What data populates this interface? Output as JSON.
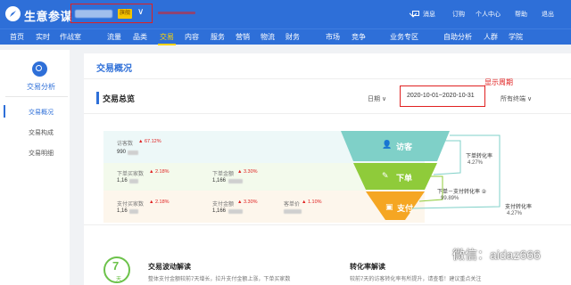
{
  "header": {
    "app_title": "生意参谋",
    "shop_badge": "旗舰",
    "links": [
      "消息",
      "订购",
      "个人中心",
      "帮助",
      "退出"
    ]
  },
  "nav": {
    "items": [
      "首页",
      "实时",
      "作战室",
      "流量",
      "品类",
      "交易",
      "内容",
      "服务",
      "营销",
      "物流",
      "财务",
      "市场",
      "竞争",
      "业务专区",
      "自助分析",
      "人群",
      "学院"
    ],
    "active": "交易"
  },
  "sidebar": {
    "title": "交易分析",
    "items": [
      "交易概况",
      "交易构成",
      "交易明细"
    ],
    "active": "交易概况"
  },
  "page": {
    "title": "交易概况",
    "summary_title": "交易总览",
    "period_label": "日期 ∨",
    "period_annotation": "显示周期",
    "date_range": "2020-10-01~2020-10-31",
    "terminal_label": "所有终端 ∨"
  },
  "metrics": {
    "row1": {
      "label": "访客数",
      "change": "▲ 67.12%",
      "value": "990"
    },
    "row2": [
      {
        "label": "下单买家数",
        "change": "▲ 2.18%",
        "value": "1,16"
      },
      {
        "label": "下单金额",
        "change": "▲ 3.30%",
        "value": "1,166"
      }
    ],
    "row3": [
      {
        "label": "支付买家数",
        "change": "▲ 2.18%",
        "value": "1,16"
      },
      {
        "label": "支付金额",
        "change": "▲ 3.30%",
        "value": "1,166"
      },
      {
        "label": "客单价",
        "change": "▲ 1.10%",
        "value": ""
      }
    ]
  },
  "funnel": {
    "stages": [
      "访客",
      "下单",
      "支付"
    ],
    "colors": {
      "visit": "#7fd0c8",
      "order": "#8fcb3a",
      "pay": "#f5a623"
    },
    "conversions": [
      {
        "label": "下单转化率",
        "value": "4.27%"
      },
      {
        "label": "下单－支付转化率 ②",
        "value": "99.89%"
      },
      {
        "label": "支付转化率",
        "value": "4.27%"
      }
    ]
  },
  "bottom": {
    "days_number": "7",
    "days_unit": "天",
    "fluctuation_title": "交易波动解读",
    "fluctuation_text": "整体支付金额较前7天增长，拉升支付金额上涨，下单买家数",
    "conversion_title": "转化率解读",
    "conversion_text": "较前7天的访客转化率有所提升，请查看！建议重点关注"
  },
  "watermark": "微信：aidaz666"
}
